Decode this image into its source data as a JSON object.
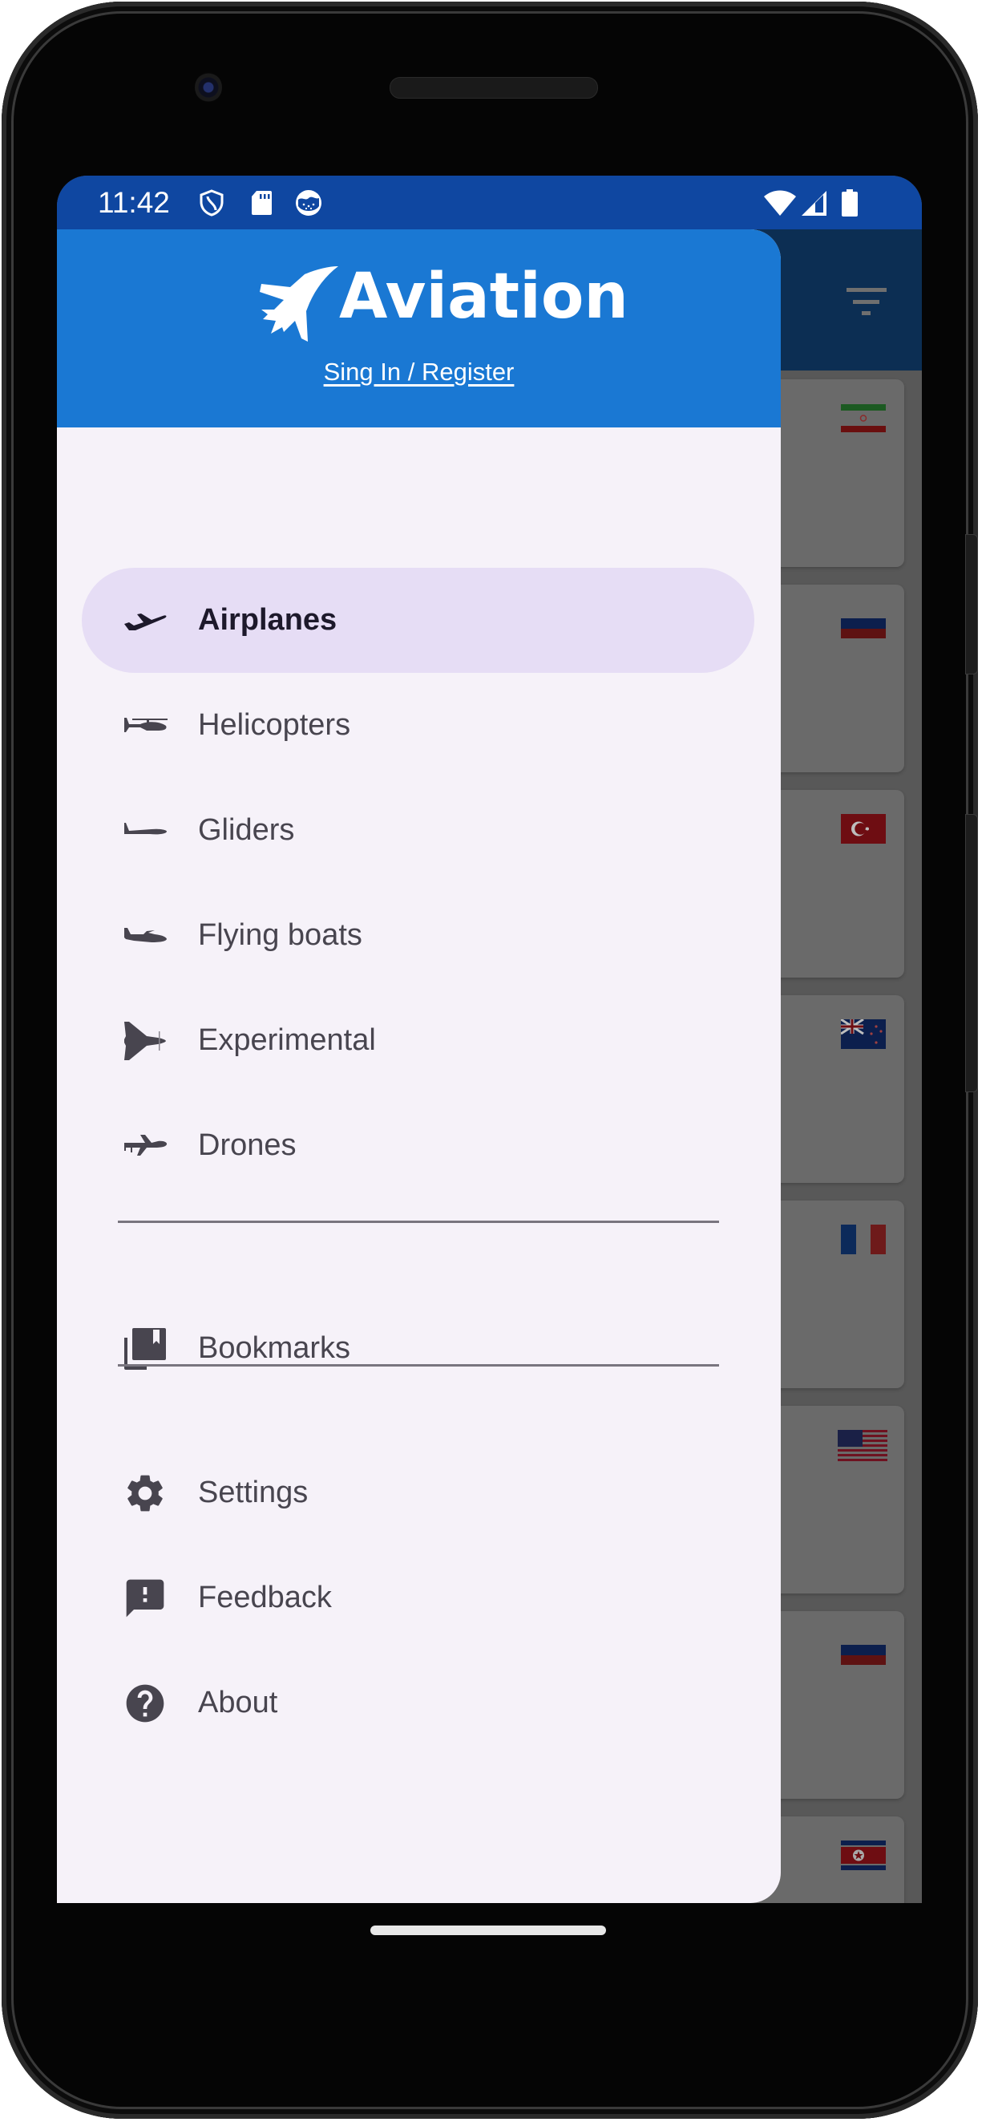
{
  "status_bar": {
    "time": "11:42",
    "left_icons": [
      "shield-icon",
      "sd-card-icon",
      "globe-icon"
    ],
    "right_icons": [
      "wifi-icon",
      "cell-signal-icon",
      "battery-icon"
    ]
  },
  "app_bar": {
    "actions": [
      "filter-icon"
    ]
  },
  "drawer": {
    "header": {
      "app_name": "Aviation",
      "logo_icon": "fighter-jet-icon",
      "signin_link": "Sing In / Register"
    },
    "categories": [
      {
        "label": "Airplanes",
        "icon": "airplane-icon",
        "selected": true
      },
      {
        "label": "Helicopters",
        "icon": "helicopter-icon",
        "selected": false
      },
      {
        "label": "Gliders",
        "icon": "glider-icon",
        "selected": false
      },
      {
        "label": "Flying boats",
        "icon": "flying-boat-icon",
        "selected": false
      },
      {
        "label": "Experimental",
        "icon": "experimental-jet-icon",
        "selected": false
      },
      {
        "label": "Drones",
        "icon": "drone-icon",
        "selected": false
      }
    ],
    "library": [
      {
        "label": "Bookmarks",
        "icon": "bookmarks-icon"
      }
    ],
    "app": [
      {
        "label": "Settings",
        "icon": "gear-icon"
      },
      {
        "label": "Feedback",
        "icon": "feedback-icon"
      },
      {
        "label": "About",
        "icon": "help-icon"
      }
    ]
  },
  "background_list": {
    "cards": [
      {
        "flag": "Iran"
      },
      {
        "flag": "Russia"
      },
      {
        "flag": "Turkey"
      },
      {
        "flag": "New Zealand"
      },
      {
        "flag": "France"
      },
      {
        "flag": "United States"
      },
      {
        "flag": "Russia"
      },
      {
        "flag": "North Korea"
      }
    ]
  },
  "colors": {
    "status_bar": "#0f47a1",
    "drawer_header": "#1a78d3",
    "drawer_background": "#f6f2f9",
    "selected_item": "#e6ddf5",
    "scrim": "#585858"
  }
}
